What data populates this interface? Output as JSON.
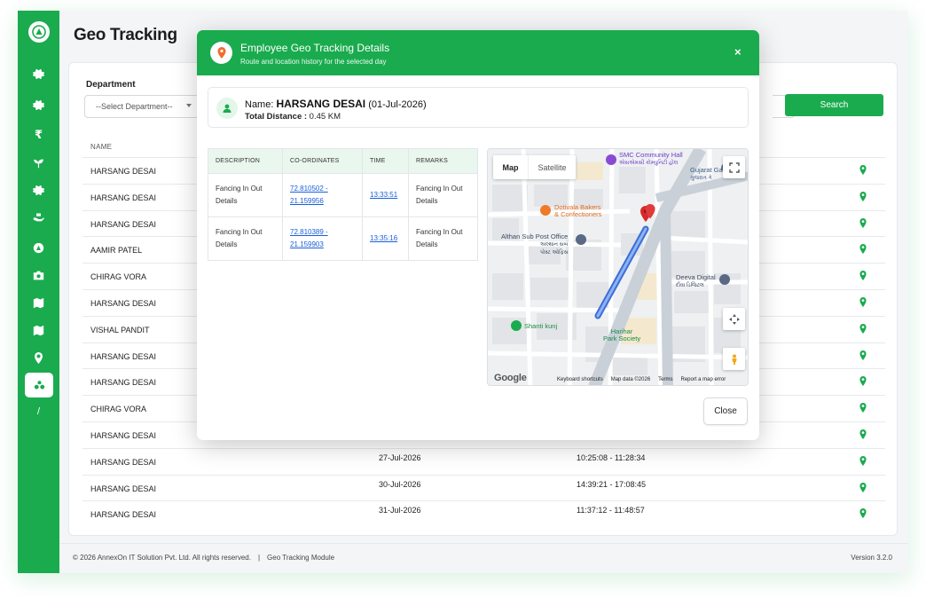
{
  "page": {
    "title": "Geo Tracking"
  },
  "sidebar": {
    "icons": [
      "gear-icon",
      "settings-icon",
      "rupee-icon",
      "plant-icon",
      "settings-icon",
      "hand-icon",
      "app-icon",
      "camera-icon",
      "map-icon",
      "map-icon",
      "location-icon",
      "geo-tracking-icon"
    ],
    "slash": "/"
  },
  "filters": {
    "department_label": "Department",
    "department_value": "--Select Department--",
    "search_label": "Search"
  },
  "table": {
    "name_header": "NAME",
    "rows": [
      {
        "name": "HARSANG DESAI",
        "date": "",
        "time": ""
      },
      {
        "name": "HARSANG DESAI",
        "date": "",
        "time": ""
      },
      {
        "name": "HARSANG DESAI",
        "date": "",
        "time": ""
      },
      {
        "name": "AAMIR PATEL",
        "date": "",
        "time": ""
      },
      {
        "name": "CHIRAG VORA",
        "date": "",
        "time": ""
      },
      {
        "name": "HARSANG DESAI",
        "date": "",
        "time": ""
      },
      {
        "name": "VISHAL PANDIT",
        "date": "",
        "time": ""
      },
      {
        "name": "HARSANG DESAI",
        "date": "",
        "time": ""
      },
      {
        "name": "HARSANG DESAI",
        "date": "",
        "time": ""
      },
      {
        "name": "CHIRAG VORA",
        "date": "",
        "time": ""
      },
      {
        "name": "HARSANG DESAI",
        "date": "",
        "time": ""
      },
      {
        "name": "HARSANG DESAI",
        "date": "27-Jul-2026",
        "time": "10:25:08 - 11:28:34"
      },
      {
        "name": "HARSANG DESAI",
        "date": "30-Jul-2026",
        "time": "14:39:21 - 17:08:45"
      },
      {
        "name": "HARSANG DESAI",
        "date": "31-Jul-2026",
        "time": "11:37:12 - 11:48:57"
      }
    ]
  },
  "footer": {
    "copyright": "© 2026 AnnexOn IT Solution Pvt. Ltd. All rights reserved.",
    "separator": "|",
    "module": "Geo Tracking Module",
    "version": "Version 3.2.0"
  },
  "modal": {
    "title": "Employee Geo Tracking Details",
    "subtitle": "Route and location history for the selected day",
    "close_icon": "×",
    "employee": {
      "name_prefix": "Name: ",
      "name": "HARSANG DESAI",
      "date": " (01-Jul-2026)",
      "distance_label": "Total Distance : ",
      "distance_value": "0.45 KM"
    },
    "columns": [
      "DESCRIPTION",
      "CO-ORDINATES",
      "TIME",
      "REMARKS"
    ],
    "records": [
      {
        "description": "Fancing In Out Details",
        "coordinates": "72.810502 - 21.159956",
        "time": "13:33:51",
        "remarks": "Fancing In Out Details"
      },
      {
        "description": "Fancing In Out Details",
        "coordinates": "72.810389 - 21.159903",
        "time": "13:35:16",
        "remarks": "Fancing In Out Details"
      }
    ],
    "close_label": "Close"
  },
  "map": {
    "toggle_map": "Map",
    "toggle_satellite": "Satellite",
    "places": {
      "smc": "SMC Community Hall",
      "smc_local": "એસએમસી કોમ્યુનિટી હોલ",
      "gujarat": "Gujarat Ga",
      "gujarat_local": "ગુજરાત ગે",
      "dotivala1": "Dotivala Bakers",
      "dotivala2": "& Confectioners",
      "althan": "Althan Sub Post Office",
      "althan_local1": "અલ્થાન સબ",
      "althan_local2": "પોસ્ટ ઓફિસ",
      "deeva": "Deeva Digital",
      "deeva_local": "દીવા ડિજિટલ",
      "shanti": "Shanti kunj",
      "harihar1": "Harihar",
      "harihar2": "Park Society"
    },
    "google": "Google",
    "footer": [
      "Keyboard shortcuts",
      "Map data ©2026",
      "Terms",
      "Report a map error"
    ]
  },
  "colors": {
    "brand": "#1aab4e",
    "link": "#1a5fd8",
    "route": "#4a7de8"
  }
}
